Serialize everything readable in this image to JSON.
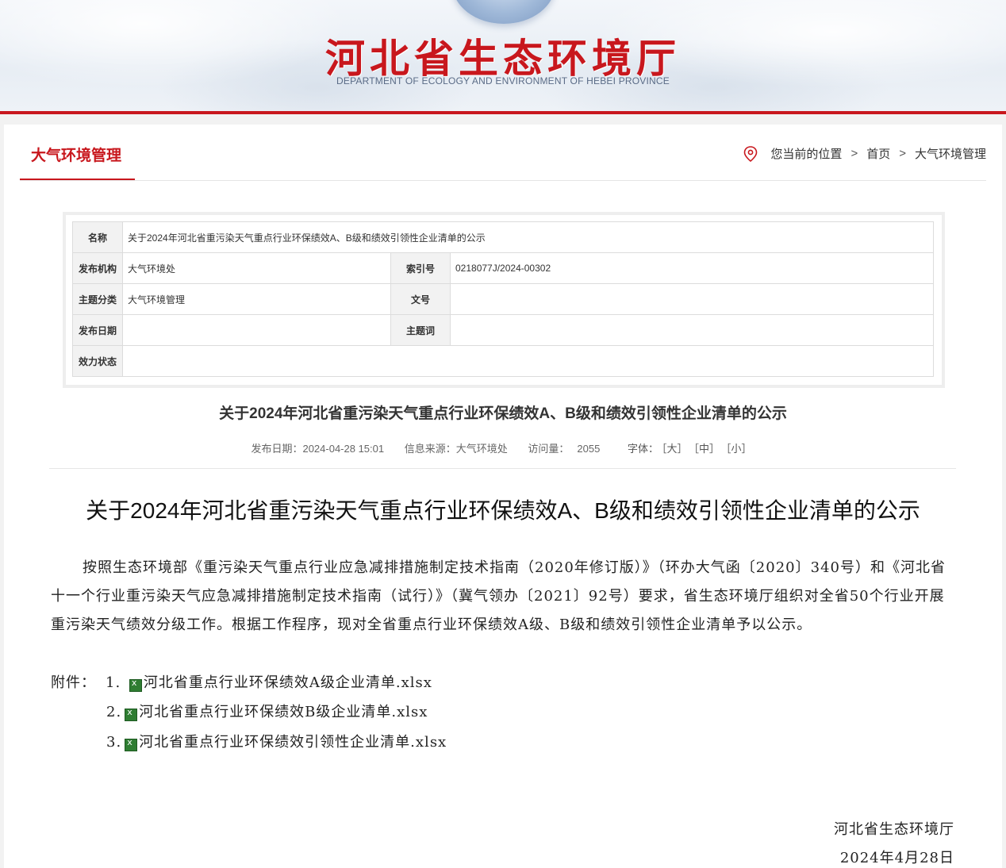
{
  "header": {
    "site_title": "河北省生态环境厅",
    "site_subtitle": "DEPARTMENT OF ECOLOGY AND ENVIRONMENT OF HEBEI PROVINCE"
  },
  "section": {
    "title": "大气环境管理"
  },
  "breadcrumb": {
    "prefix": "您当前的位置",
    "items": [
      "首页",
      "大气环境管理"
    ],
    "separator": ">"
  },
  "info_table": {
    "name_label": "名称",
    "name_value": "关于2024年河北省重污染天气重点行业环保绩效A、B级和绩效引领性企业清单的公示",
    "org_label": "发布机构",
    "org_value": "大气环境处",
    "index_label": "索引号",
    "index_value": "0218077J/2024-00302",
    "category_label": "主题分类",
    "category_value": "大气环境管理",
    "docno_label": "文号",
    "docno_value": "",
    "date_label": "发布日期",
    "date_value": "",
    "keyword_label": "主题词",
    "keyword_value": "",
    "status_label": "效力状态",
    "status_value": ""
  },
  "article": {
    "title": "关于2024年河北省重污染天气重点行业环保绩效A、B级和绩效引领性企业清单的公示",
    "meta_date": "发布日期：2024-04-28 15:01",
    "meta_source": "信息来源：大气环境处",
    "meta_views_label": "访问量：",
    "meta_views": "2055",
    "font_label": "字体：",
    "font_large": "［大］",
    "font_medium": "［中］",
    "font_small": "［小］",
    "doc_title": "关于2024年河北省重污染天气重点行业环保绩效A、B级和绩效引领性企业清单的公示",
    "body": "按照生态环境部《重污染天气重点行业应急减排措施制定技术指南（2020年修订版）》（环办大气函〔2020〕340号）和《河北省十一个行业重污染天气应急减排措施制定技术指南（试行）》（冀气领办〔2021〕92号）要求，省生态环境厅组织对全省50个行业开展重污染天气绩效分级工作。根据工作程序，现对全省重点行业环保绩效A级、B级和绩效引领性企业清单予以公示。",
    "attach_label": "附件：",
    "attachments": [
      {
        "num": "1.",
        "name": "河北省重点行业环保绩效A级企业清单.xlsx"
      },
      {
        "num": "2.",
        "name": "河北省重点行业环保绩效B级企业清单.xlsx"
      },
      {
        "num": "3.",
        "name": "河北省重点行业环保绩效引领性企业清单.xlsx"
      }
    ],
    "sign_org": "河北省生态环境厅",
    "sign_date": "2024年4月28日",
    "icon_name": "excel-file-icon",
    "accent_color": "#c8171d"
  }
}
